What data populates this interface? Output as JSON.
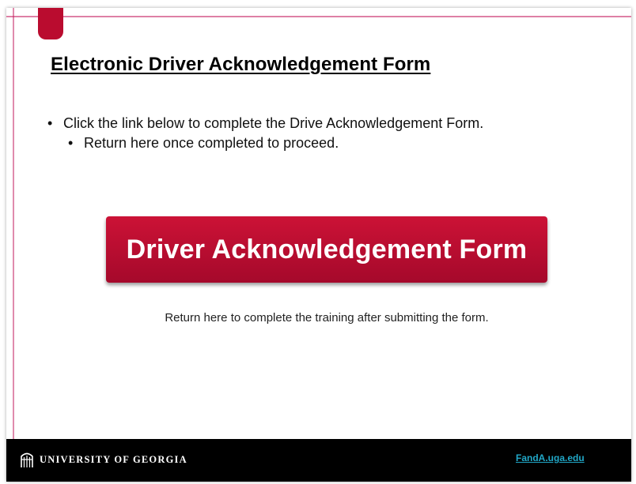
{
  "slide": {
    "title": "Electronic Driver Acknowledgement Form",
    "bullets": [
      {
        "text": "Click the link below to complete the Drive Acknowledgement Form.",
        "level": 1
      },
      {
        "text": "Return here once completed to proceed.",
        "level": 2
      }
    ],
    "bullet_glyph": "•",
    "button_label": "Driver Acknowledgement Form",
    "note": "Return here to complete the training after submitting the form."
  },
  "footer": {
    "wordmark": "UNIVERSITY OF GEORGIA",
    "link_text": "FandA.uga.edu"
  },
  "colors": {
    "brand_red": "#ba0c2f",
    "footer_background": "#000000",
    "link_color": "#21a7c7"
  },
  "icons": {
    "bookmark": "bookmark-tab",
    "logo": "arch-icon"
  }
}
